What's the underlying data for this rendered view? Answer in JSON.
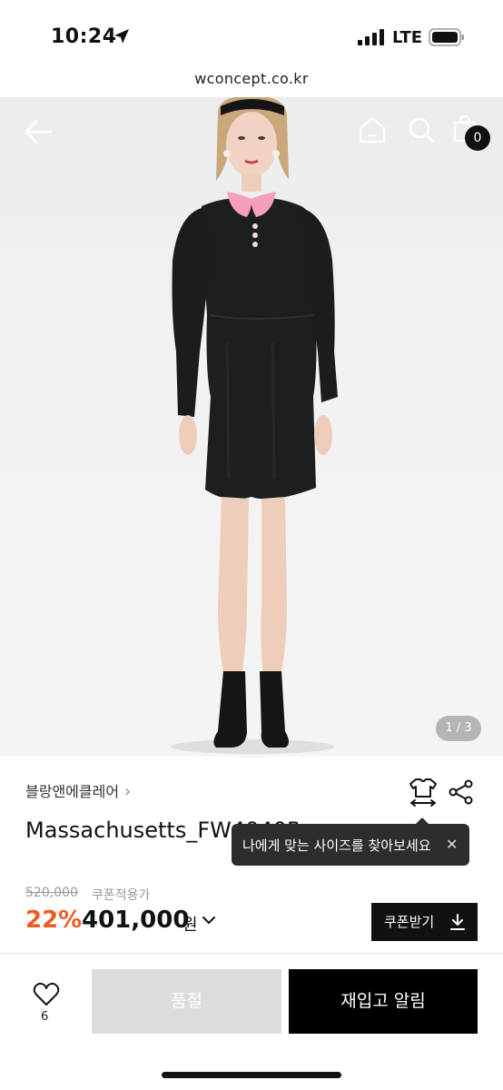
{
  "status_bar": {
    "time": "10:24",
    "network": "LTE"
  },
  "browser": {
    "url": "wconcept.co.kr"
  },
  "header": {
    "cart_count": "0"
  },
  "gallery": {
    "indicator": "1 / 3"
  },
  "product": {
    "brand": "블랑앤에클레어",
    "brand_chevron": "›",
    "name": "Massachusetts_FW4040BL",
    "original_price": "520,000",
    "coupon_label": "쿠폰적용가",
    "discount": "22%",
    "price": "401,000",
    "currency": "원",
    "coupon_button": "쿠폰받기"
  },
  "tooltip": {
    "text": "나에게 맞는 사이즈를 찾아보세요",
    "close": "✕"
  },
  "bottom_bar": {
    "like_count": "6",
    "soldout_label": "품절",
    "restock_label": "재입고 알림"
  },
  "colors": {
    "accent": "#f05a24",
    "collar": "#f4a0b8",
    "dress": "#1c1f20"
  }
}
